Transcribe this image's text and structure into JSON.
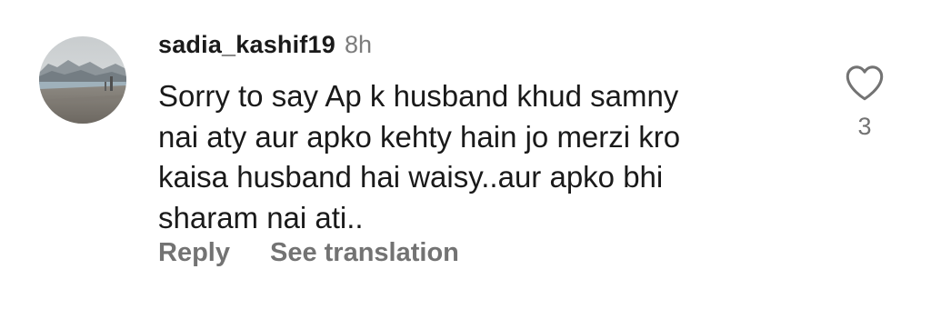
{
  "comment": {
    "username": "sadia_kashif19",
    "timestamp": "8h",
    "text_lines": [
      "Sorry to say Ap k husband khud samny",
      "nai aty aur apko kehty hain jo merzi kro",
      "kaisa husband hai waisy..aur apko bhi",
      "sharam nai ati.."
    ],
    "actions": {
      "reply_label": "Reply",
      "translate_label": "See translation"
    },
    "like_count": "3",
    "avatar_icon": "profile-photo-beach",
    "like_icon": "heart-outline-icon"
  },
  "colors": {
    "text_primary": "#1a1a1a",
    "text_secondary": "#737373",
    "timestamp": "#7c7c7c",
    "background": "#ffffff"
  }
}
